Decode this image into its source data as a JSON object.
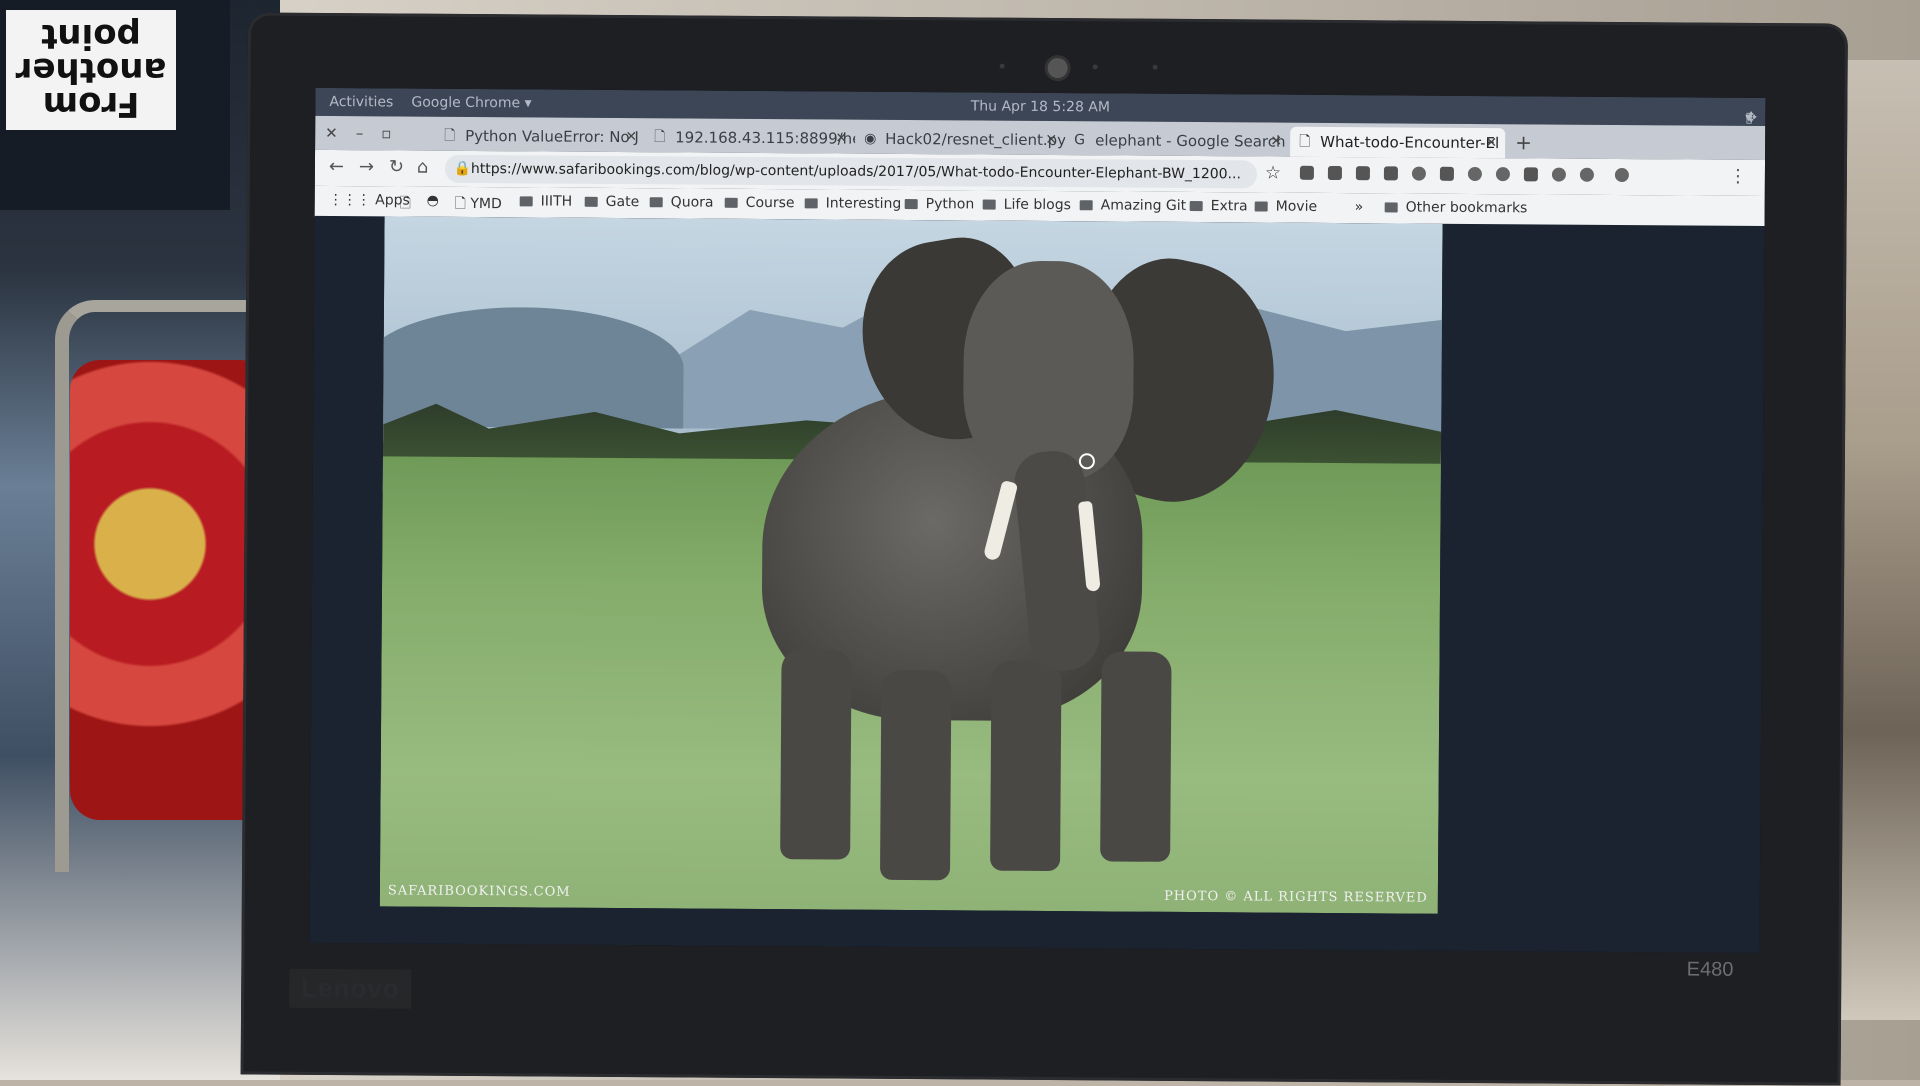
{
  "shirt": {
    "line1": "From",
    "line2": "another",
    "line3": "point"
  },
  "laptop": {
    "brand": "Lenovo",
    "model": "E480"
  },
  "desktop": {
    "activities": "Activities",
    "app_menu": "Google Chrome ▾",
    "clock": "Thu Apr 18  5:28 AM"
  },
  "tabs": [
    {
      "title": "Python ValueError: No J",
      "icon": "page-icon"
    },
    {
      "title": "192.168.43.115:8899/hea",
      "icon": "page-icon"
    },
    {
      "title": "Hack02/resnet_client.py",
      "icon": "github-icon"
    },
    {
      "title": "elephant - Google Search",
      "icon": "google-icon"
    },
    {
      "title": "What-todo-Encounter-El",
      "icon": "page-icon",
      "active": true
    }
  ],
  "address_bar": {
    "url": "https://www.safaribookings.com/blog/wp-content/uploads/2017/05/What-todo-Encounter-Elephant-BW_1200..."
  },
  "bookmarks": {
    "apps": "Apps",
    "items": [
      "YMD",
      "IIITH",
      "Gate",
      "Quora",
      "Course",
      "Interesting",
      "Python",
      "Life blogs",
      "Amazing Git",
      "Extra",
      "Movie"
    ],
    "overflow": "»",
    "other": "Other bookmarks"
  },
  "photo": {
    "watermark_left": "SAFARIBOOKINGS.COM",
    "watermark_right": "PHOTO © ALL RIGHTS RESERVED"
  }
}
